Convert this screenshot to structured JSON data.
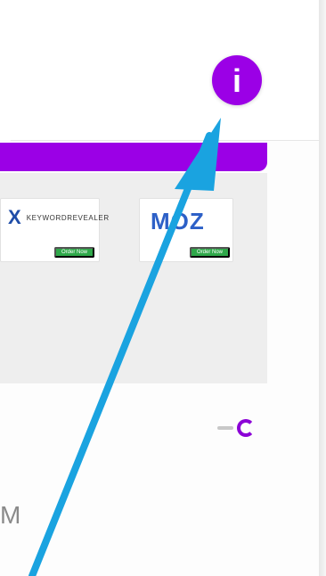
{
  "header": {
    "info_button": {
      "label": "i"
    }
  },
  "panel": {
    "cards": [
      {
        "brand": "KEYWORDREVEALER",
        "button_label": "Order Now"
      },
      {
        "brand": "MOZ",
        "button_label": "Order Now"
      }
    ]
  },
  "footer": {
    "partial_text": "M"
  },
  "colors": {
    "purple": "#9b00e6",
    "green_button": "#2fa84a",
    "arrow_blue": "#1aa3e0",
    "moz_blue": "#2d60c7",
    "kr_blue": "#1f4da8"
  },
  "icons": {
    "info": "info-icon",
    "annotation_arrow": "arrow-icon",
    "progress": "loading-ring-icon"
  }
}
